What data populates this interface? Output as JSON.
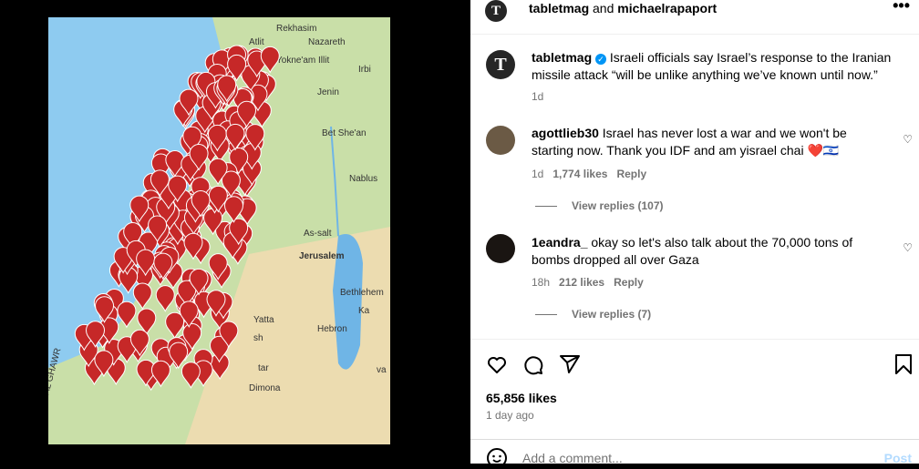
{
  "media": {
    "map_labels": [
      "Rekhasim",
      "Atlit",
      "Nazareth",
      "Yokne'am Illit",
      "Irbi",
      "Jenin",
      "Bet She'an",
      "Nablus",
      "As-salt",
      "Jerusalem",
      "Bethlehem",
      "Hebron",
      "Yatta",
      "Dimona",
      "AL GHAWR",
      "sh",
      "tar",
      "va",
      "Ka"
    ],
    "pin_color": "#c62828",
    "sea_color": "#8ecbf0"
  },
  "header": {
    "user1": "tabletmag",
    "joiner": "and",
    "user2": "michaelrapaport",
    "more_icon": "more-horizontal-icon"
  },
  "caption": {
    "user": "tabletmag",
    "text": "Israeli officials say Israel’s response to the Iranian missile attack “will be unlike anything we’ve known until now.”",
    "time": "1d"
  },
  "comments": [
    {
      "user": "agottlieb30",
      "text": "Israel has never lost a war and we won't be starting now. Thank you IDF and am yisrael chai ❤️🇮🇱",
      "time": "1d",
      "likes": "1,774 likes",
      "reply": "Reply",
      "view_replies": "View replies (107)"
    },
    {
      "user": "1eandra_",
      "text": "okay so let's also talk about the 70,000 tons of bombs dropped all over Gaza",
      "time": "18h",
      "likes": "212 likes",
      "reply": "Reply",
      "view_replies": "View replies (7)"
    }
  ],
  "likes": "65,856 likes",
  "posted": "1 day ago",
  "add_comment": {
    "placeholder": "Add a comment...",
    "post": "Post"
  }
}
